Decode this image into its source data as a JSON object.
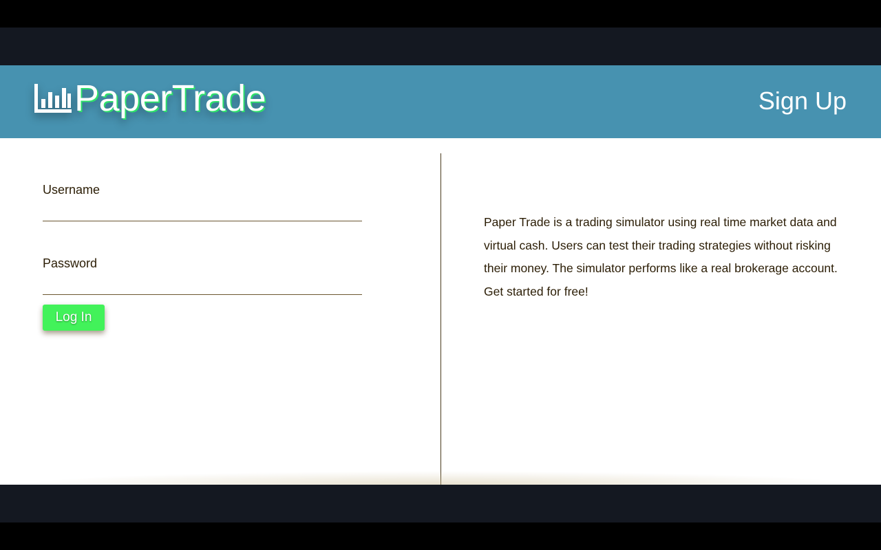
{
  "header": {
    "logo_text": "PaperTrade",
    "logo_icon": "bar-chart-icon",
    "signup_label": "Sign Up"
  },
  "login_form": {
    "username_label": "Username",
    "username_value": "",
    "password_label": "Password",
    "password_value": "",
    "login_label": "Log In"
  },
  "about": {
    "text": "Paper Trade is a trading simulator using real time market data and virtual cash. Users can test their trading strategies without risking their money. The simulator performs like a real brokerage account. Get started for free!"
  },
  "colors": {
    "header_bg": "#4792b0",
    "page_bg": "#141821",
    "accent_green": "#42f25a",
    "text": "#2b1d05"
  }
}
